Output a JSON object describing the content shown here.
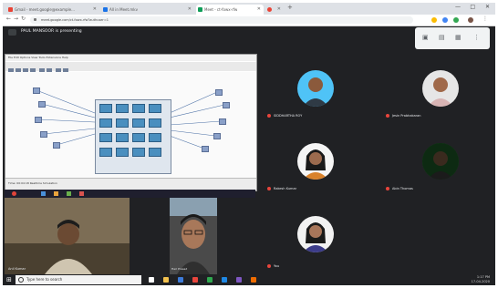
{
  "browser": {
    "tabs": [
      {
        "label": "Gmail - meet.google@example...",
        "favicon_color": "#ea4335",
        "active": false
      },
      {
        "label": "All in Meet.mkv",
        "favicon_color": "#1a73e8",
        "active": false
      },
      {
        "label": "Meet - ct-fowx-rfw",
        "favicon_color": "#0f9d58",
        "active": true
      },
      {
        "label": "",
        "favicon_color": "#ea4335",
        "active": false
      }
    ],
    "url": "meet.google.com/ct-fowx-rfw?authuser=1",
    "window_controls": [
      "—",
      "□",
      "✕"
    ]
  },
  "meeting": {
    "title": "PAUL MANSOOR is presenting"
  },
  "presentation": {
    "menu_text": "File  Edit  Options  View  Tools  Extensions  Help",
    "status_text": "Time: 00:04:18  Realtime  Simulation"
  },
  "participants": [
    {
      "name": "SIDDHARTHA ROY",
      "position": "row1-col1",
      "skin": "#8b5a3c",
      "bg": "#4fc3f7"
    },
    {
      "name": "Jesin Prabhakaran",
      "position": "row1-col2",
      "skin": "#a0694a",
      "bg": "#e6e6e6"
    },
    {
      "name": "Rakesh Kumar",
      "position": "row2-col1",
      "skin": "#9c6b4e",
      "bg": "#f5f5f5"
    },
    {
      "name": "Abin Thomas",
      "position": "row2-col2",
      "skin": "#3a2a1e",
      "bg": "#1b5e20"
    },
    {
      "name": "You",
      "position": "row3-col1",
      "skin": "#a8765a",
      "bg": "#f2f2f2"
    }
  ],
  "webcams": [
    {
      "name": "Anil Kumar"
    },
    {
      "name": "Hari Prasad"
    }
  ],
  "taskbar": {
    "search_placeholder": "Type here to search",
    "time": "1:17 PM",
    "date": "17-04-2020"
  }
}
